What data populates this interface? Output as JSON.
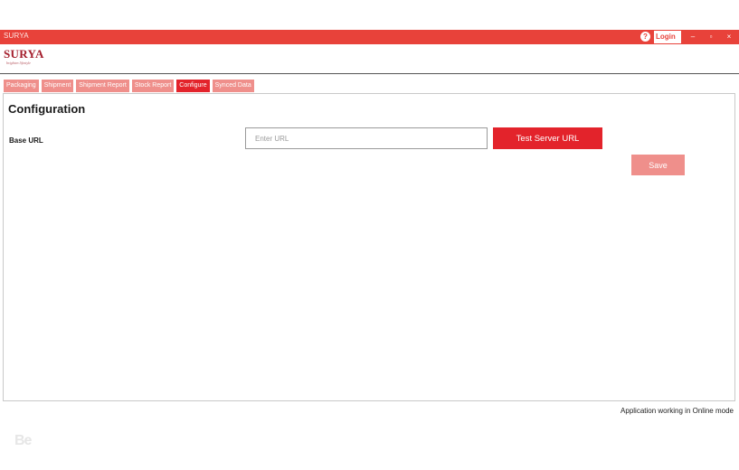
{
  "window": {
    "title": "SURYA",
    "login_label": "Login",
    "help_icon": "?",
    "minimize_icon": "–",
    "restore_icon": "▫",
    "close_icon": "×"
  },
  "brand": {
    "logo_text": "SURYA",
    "tagline": "brighten lifestyle"
  },
  "tabs": [
    {
      "label": "Packaging",
      "active": false
    },
    {
      "label": "Shipment",
      "active": false
    },
    {
      "label": "Shipment Report",
      "active": false
    },
    {
      "label": "Stock Report",
      "active": false
    },
    {
      "label": "Configure",
      "active": true
    },
    {
      "label": "Synced Data",
      "active": false
    }
  ],
  "configuration": {
    "title": "Configuration",
    "base_url_label": "Base URL",
    "url_value": "",
    "url_placeholder": "Enter URL",
    "test_button": "Test Server URL",
    "save_button": "Save"
  },
  "status": {
    "text": "Application working in Online mode"
  },
  "watermark": {
    "text": "Be"
  },
  "colors": {
    "accent": "#e3232b",
    "titlebar": "#e8423a",
    "inactive_tab": "#ef8f8b",
    "logo": "#a41e2c"
  }
}
